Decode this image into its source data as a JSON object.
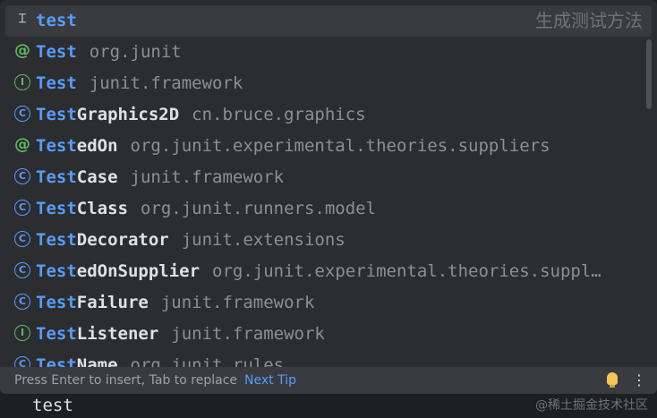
{
  "popup": {
    "items": [
      {
        "icon": "template-icon",
        "glyph": "⌶",
        "match": "test",
        "rest": "",
        "pkg": "",
        "hint": "生成测试方法",
        "selected": true
      },
      {
        "icon": "annotation-icon",
        "glyph": "@",
        "match": "Test",
        "rest": "",
        "pkg": "org.junit"
      },
      {
        "icon": "interface-icon",
        "glyph": "I",
        "match": "Test",
        "rest": "",
        "pkg": "junit.framework"
      },
      {
        "icon": "class-icon",
        "glyph": "C",
        "match": "Test",
        "rest": "Graphics2D",
        "pkg": "cn.bruce.graphics"
      },
      {
        "icon": "annotation-icon",
        "glyph": "@",
        "match": "Test",
        "rest": "edOn",
        "pkg": "org.junit.experimental.theories.suppliers"
      },
      {
        "icon": "class-icon",
        "glyph": "C",
        "match": "Test",
        "rest": "Case",
        "pkg": "junit.framework"
      },
      {
        "icon": "class-icon",
        "glyph": "C",
        "match": "Test",
        "rest": "Class",
        "pkg": "org.junit.runners.model"
      },
      {
        "icon": "class-icon",
        "glyph": "C",
        "match": "Test",
        "rest": "Decorator",
        "pkg": "junit.extensions"
      },
      {
        "icon": "class-icon",
        "glyph": "C",
        "match": "Test",
        "rest": "edOnSupplier",
        "pkg": "org.junit.experimental.theories.suppl…"
      },
      {
        "icon": "class-icon",
        "glyph": "C",
        "match": "Test",
        "rest": "Failure",
        "pkg": "junit.framework"
      },
      {
        "icon": "interface-icon",
        "glyph": "I",
        "match": "Test",
        "rest": "Listener",
        "pkg": "junit.framework"
      },
      {
        "icon": "class-icon",
        "glyph": "C",
        "match": "Test",
        "rest": "Name",
        "pkg": "org.junit.rules"
      }
    ],
    "footer": {
      "hint": "Press Enter to insert, Tab to replace",
      "next_tip": "Next Tip",
      "more": "⋮"
    }
  },
  "editor": {
    "text": "test"
  },
  "watermark": "@稀土掘金技术社区",
  "colors": {
    "match": "#5a9bf8",
    "annotation": "#5fb865",
    "interface": "#5fb865",
    "class": "#5a9bf8",
    "package": "#8c8f96"
  }
}
